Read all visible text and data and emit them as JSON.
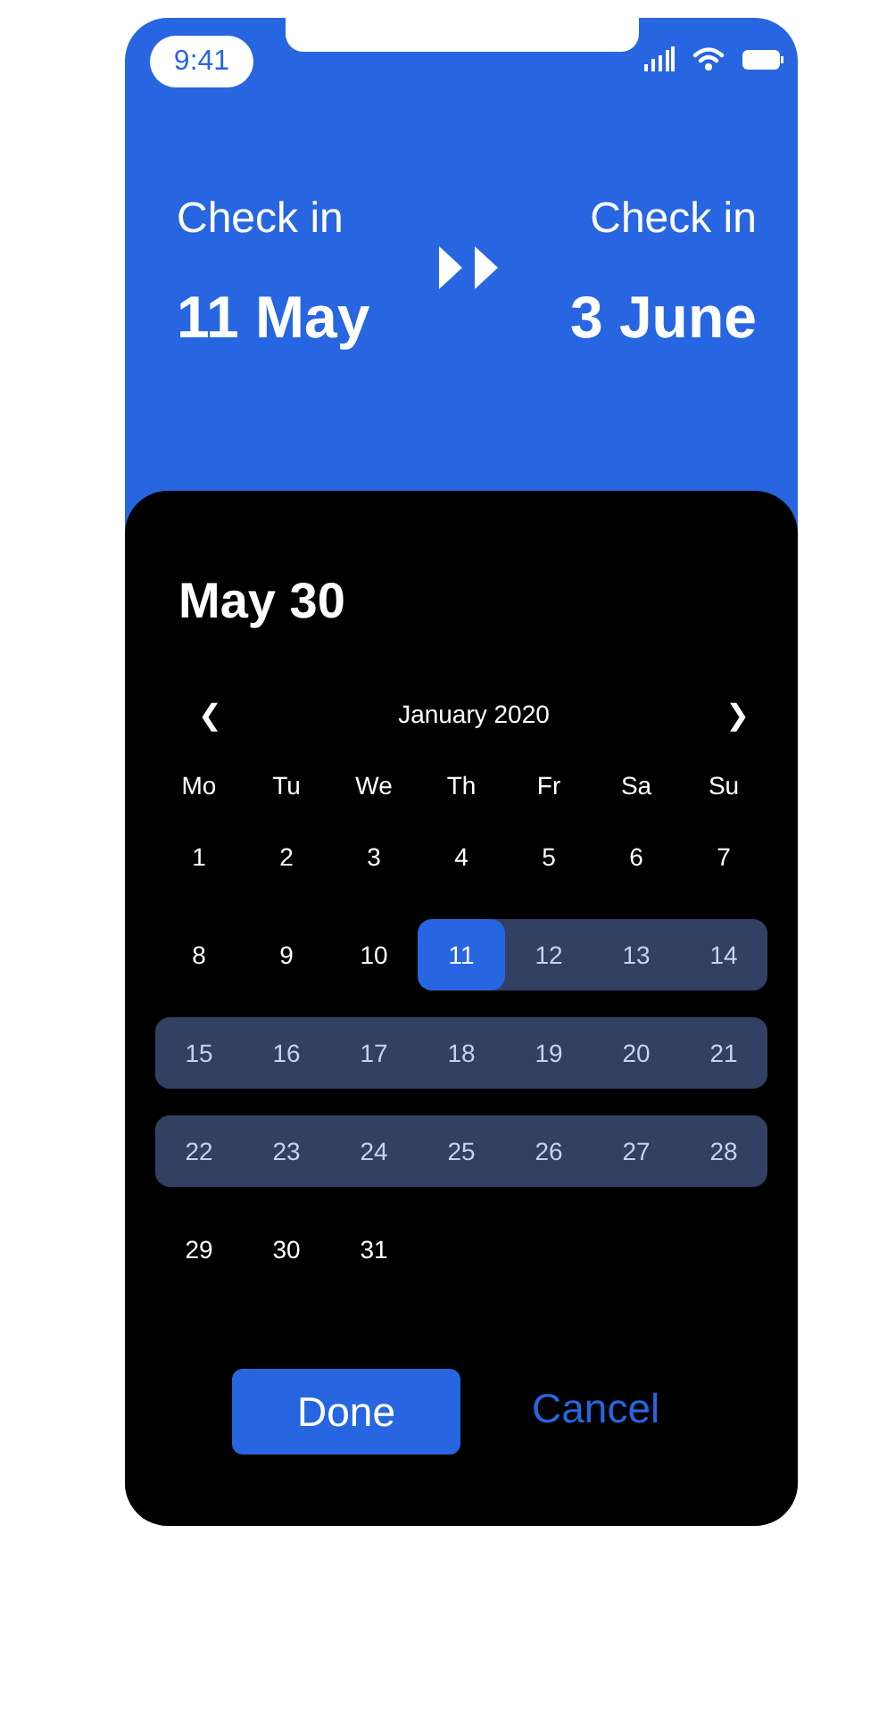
{
  "status_bar": {
    "time": "9:41"
  },
  "trip": {
    "from": {
      "label": "Check in",
      "date": "11 May"
    },
    "to": {
      "label": "Check in",
      "date": "3 June"
    }
  },
  "picker": {
    "title": "May 30",
    "month": "January 2020",
    "prev": "❮",
    "next": "❯",
    "weekdays": [
      "Mo",
      "Tu",
      "We",
      "Th",
      "Fr",
      "Sa",
      "Su"
    ],
    "days": [
      {
        "label": "1",
        "selected": false,
        "in_range": false
      },
      {
        "label": "2",
        "selected": false,
        "in_range": false
      },
      {
        "label": "3",
        "selected": false,
        "in_range": false
      },
      {
        "label": "4",
        "selected": false,
        "in_range": false
      },
      {
        "label": "5",
        "selected": false,
        "in_range": false
      },
      {
        "label": "6",
        "selected": false,
        "in_range": false
      },
      {
        "label": "7",
        "selected": false,
        "in_range": false
      },
      {
        "label": "8",
        "selected": false,
        "in_range": false
      },
      {
        "label": "9",
        "selected": false,
        "in_range": false
      },
      {
        "label": "10",
        "selected": false,
        "in_range": false
      },
      {
        "label": "11",
        "selected": true,
        "in_range": false
      },
      {
        "label": "12",
        "selected": false,
        "in_range": true
      },
      {
        "label": "13",
        "selected": false,
        "in_range": true
      },
      {
        "label": "14",
        "selected": false,
        "in_range": true
      },
      {
        "label": "15",
        "selected": false,
        "in_range": true
      },
      {
        "label": "16",
        "selected": false,
        "in_range": true
      },
      {
        "label": "17",
        "selected": false,
        "in_range": true
      },
      {
        "label": "18",
        "selected": false,
        "in_range": true
      },
      {
        "label": "19",
        "selected": false,
        "in_range": true
      },
      {
        "label": "20",
        "selected": false,
        "in_range": true
      },
      {
        "label": "21",
        "selected": false,
        "in_range": true
      },
      {
        "label": "22",
        "selected": false,
        "in_range": true
      },
      {
        "label": "23",
        "selected": false,
        "in_range": true
      },
      {
        "label": "24",
        "selected": false,
        "in_range": true
      },
      {
        "label": "25",
        "selected": false,
        "in_range": true
      },
      {
        "label": "26",
        "selected": false,
        "in_range": true
      },
      {
        "label": "27",
        "selected": false,
        "in_range": true
      },
      {
        "label": "28",
        "selected": false,
        "in_range": true
      },
      {
        "label": "29",
        "selected": false,
        "in_range": false
      },
      {
        "label": "30",
        "selected": false,
        "in_range": false
      },
      {
        "label": "31",
        "selected": false,
        "in_range": false
      }
    ]
  },
  "buttons": [
    {
      "label": "Done",
      "kind": "primary"
    },
    {
      "label": "Cancel",
      "kind": "text"
    }
  ]
}
